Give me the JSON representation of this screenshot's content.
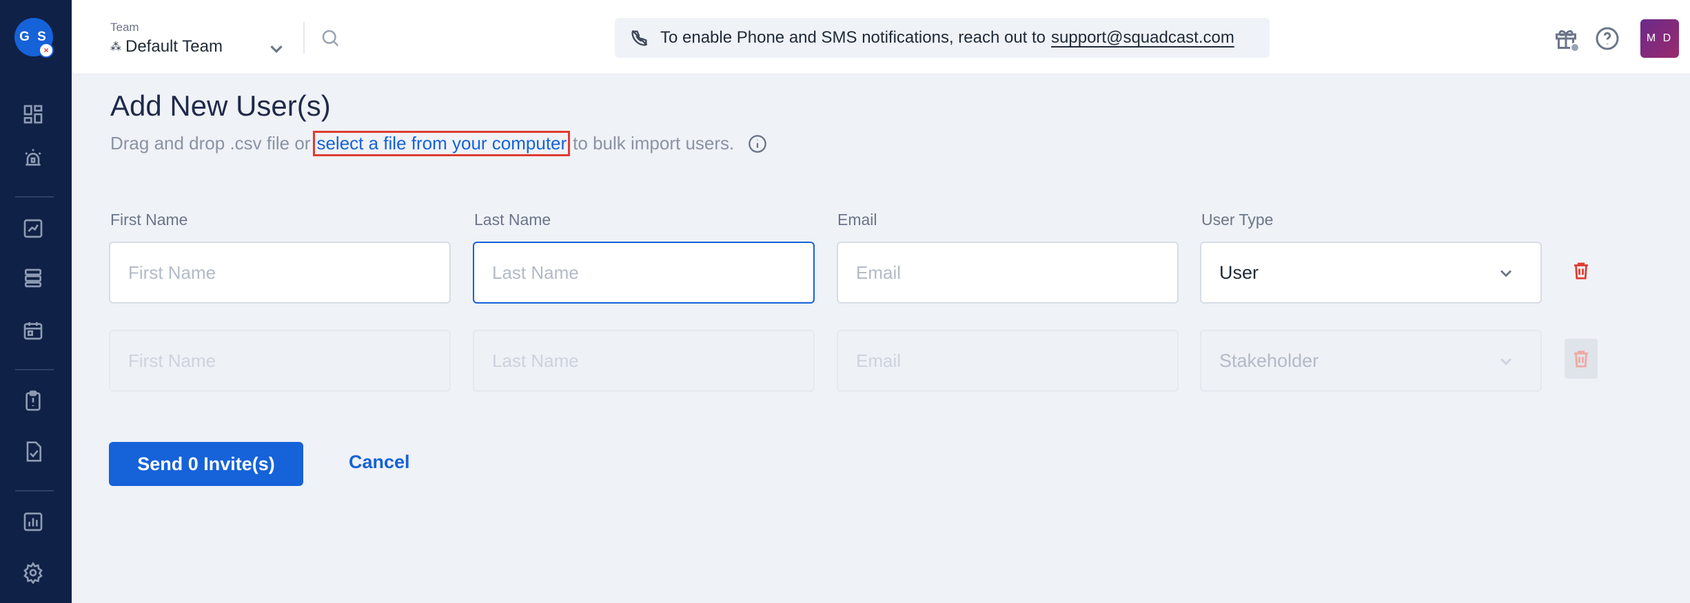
{
  "sidebar": {
    "org_initials": "G S",
    "nav_icons": [
      "dashboard-icon",
      "incidents-icon",
      "analytics-icon",
      "services-icon",
      "schedules-icon",
      "postmortems-icon",
      "runbooks-icon",
      "reports-icon",
      "settings-icon"
    ]
  },
  "header": {
    "team_caption": "Team",
    "team_name": "Default Team",
    "notice_text": "To enable Phone and SMS notifications, reach out to",
    "notice_email": "support@squadcast.com",
    "user_initials": "M D"
  },
  "main": {
    "title": "Add New User(s)",
    "subtitle_before": "Drag and drop .csv file or",
    "subtitle_link": "select a file from your computer",
    "subtitle_after": "to bulk import users.",
    "columns": {
      "first_name": "First Name",
      "last_name": "Last Name",
      "email": "Email",
      "user_type": "User Type"
    },
    "rows": [
      {
        "first_name_placeholder": "First Name",
        "last_name_placeholder": "Last Name",
        "email_placeholder": "Email",
        "user_type": "User"
      },
      {
        "first_name_placeholder": "First Name",
        "last_name_placeholder": "Last Name",
        "email_placeholder": "Email",
        "user_type": "Stakeholder"
      }
    ],
    "send_button": "Send 0 Invite(s)",
    "cancel_button": "Cancel"
  },
  "colors": {
    "sidebar_bg": "#0f2146",
    "accent": "#1662d9",
    "danger": "#e03b2f",
    "page_bg": "#eff2f7"
  }
}
